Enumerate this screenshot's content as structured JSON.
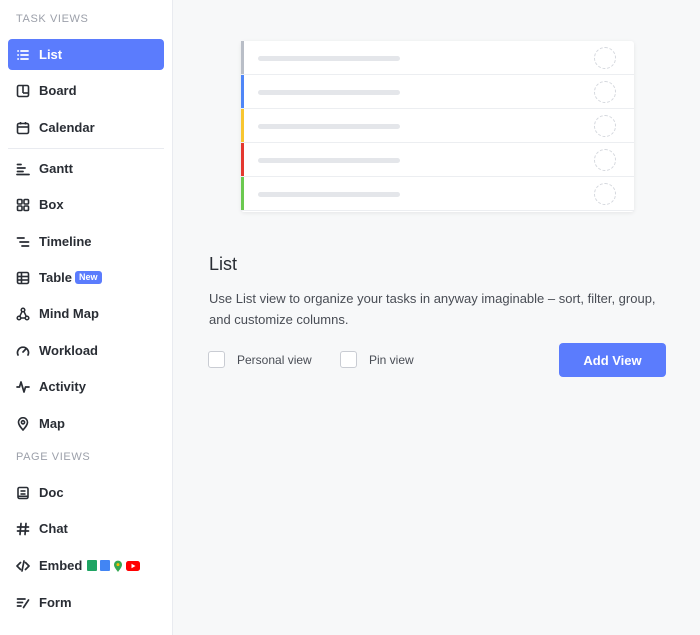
{
  "sidebar": {
    "task_views_label": "TASK VIEWS",
    "page_views_label": "PAGE VIEWS",
    "items": [
      {
        "label": "List",
        "icon": "list-icon"
      },
      {
        "label": "Board",
        "icon": "board-icon"
      },
      {
        "label": "Calendar",
        "icon": "calendar-icon"
      },
      {
        "label": "Gantt",
        "icon": "gantt-icon"
      },
      {
        "label": "Box",
        "icon": "box-icon"
      },
      {
        "label": "Timeline",
        "icon": "timeline-icon"
      },
      {
        "label": "Table",
        "icon": "table-icon",
        "badge": "New"
      },
      {
        "label": "Mind Map",
        "icon": "mind-map-icon"
      },
      {
        "label": "Workload",
        "icon": "workload-icon"
      },
      {
        "label": "Activity",
        "icon": "activity-icon"
      },
      {
        "label": "Map",
        "icon": "map-pin-icon"
      }
    ],
    "page_items": [
      {
        "label": "Doc",
        "icon": "doc-icon"
      },
      {
        "label": "Chat",
        "icon": "hashtag-icon"
      },
      {
        "label": "Embed",
        "icon": "code-icon"
      },
      {
        "label": "Form",
        "icon": "form-icon"
      }
    ]
  },
  "preview": {
    "row_colors": [
      "#b9bec7",
      "#4f86f7",
      "#f8c630",
      "#e4382f",
      "#6bc950"
    ]
  },
  "main": {
    "title": "List",
    "description": "Use List view to organize your tasks in anyway imaginable – sort, filter, group, and customize columns.",
    "personal_view_label": "Personal view",
    "pin_view_label": "Pin view",
    "add_view_label": "Add View"
  },
  "colors": {
    "accent": "#5b7cfd"
  }
}
